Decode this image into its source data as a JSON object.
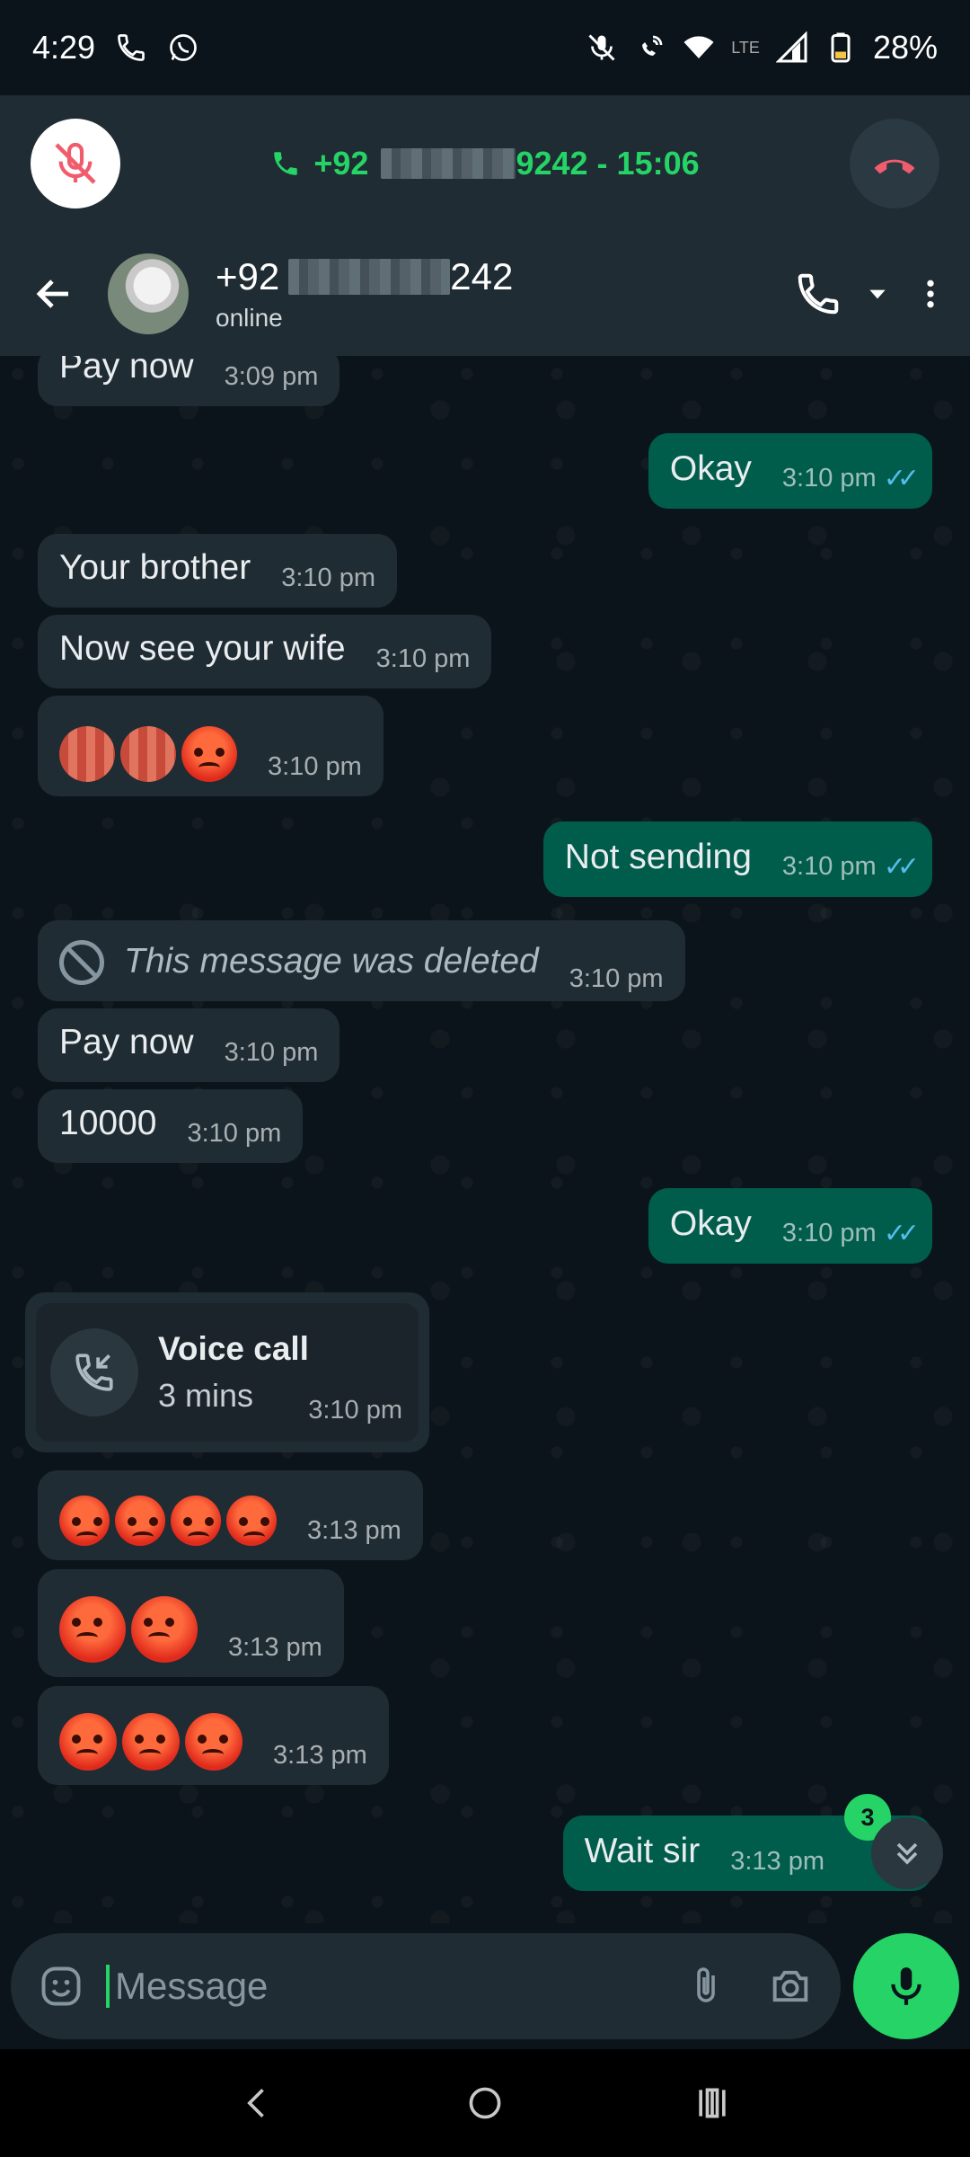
{
  "status_bar": {
    "time": "4:29",
    "battery": "28%",
    "network": "LTE"
  },
  "call_bar": {
    "number_prefix": "+92",
    "number_suffix": "9242",
    "separator": " - ",
    "duration": "15:06"
  },
  "header": {
    "name_prefix": "+92",
    "name_suffix": "242",
    "status": "online"
  },
  "messages": [
    {
      "dir": "in",
      "text": "Pay now",
      "time": "3:09 pm"
    },
    {
      "dir": "out",
      "text": "Okay",
      "time": "3:10 pm"
    },
    {
      "dir": "in",
      "text": "Your brother",
      "time": "3:10 pm"
    },
    {
      "dir": "in",
      "text": "Now see your wife",
      "time": "3:10 pm"
    },
    {
      "dir": "in",
      "emoji_count": 3,
      "time": "3:10 pm"
    },
    {
      "dir": "out",
      "text": "Not sending",
      "time": "3:10 pm"
    },
    {
      "dir": "in",
      "text": "This message was deleted",
      "time": "3:10 pm"
    },
    {
      "dir": "in",
      "text": "Pay now",
      "time": "3:10 pm"
    },
    {
      "dir": "in",
      "text": "10000",
      "time": "3:10 pm"
    },
    {
      "dir": "out",
      "text": "Okay",
      "time": "3:10 pm"
    },
    {
      "dir": "in",
      "emoji_count": 4,
      "time": "3:13 pm"
    },
    {
      "dir": "in",
      "emoji_count": 2,
      "time": "3:13 pm"
    },
    {
      "dir": "in",
      "emoji_count": 3,
      "time": "3:13 pm"
    },
    {
      "dir": "out",
      "text": "Wait sir",
      "time": "3:13 pm"
    }
  ],
  "call_card": {
    "title": "Voice call",
    "subtitle": "3 mins",
    "time": "3:10 pm"
  },
  "unread_badge": "3",
  "input": {
    "placeholder": "Message"
  },
  "icons": [
    "phone-icon",
    "whatsapp-icon",
    "mute-icon",
    "wifi-icon",
    "signal-icon",
    "battery-icon",
    "mic-off-icon",
    "end-call-icon",
    "back-arrow-icon",
    "call-icon",
    "dropdown-icon",
    "more-icon",
    "block-icon",
    "incoming-call-icon",
    "chevron-double-down-icon",
    "sticker-icon",
    "attach-icon",
    "camera-icon",
    "mic-icon",
    "nav-back-icon",
    "nav-home-icon",
    "nav-recents-icon"
  ],
  "colors": {
    "accent": "#25d366",
    "outgoing_bubble": "#005c4b",
    "incoming_bubble": "#202c33",
    "read_ticks": "#53bdeb",
    "end_call": "#f15c6d"
  }
}
